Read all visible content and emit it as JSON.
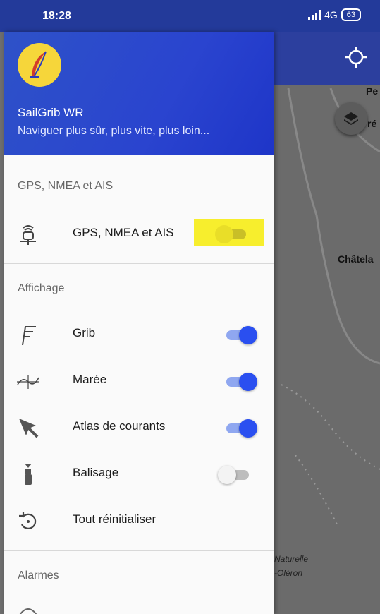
{
  "status_bar": {
    "time": "18:28",
    "network": "4G",
    "battery": "63"
  },
  "map": {
    "labels": {
      "pe": "Pe",
      "re": "ré",
      "chatelaillon": "Châtela",
      "naturelle": "Naturelle",
      "oleron": "-Oléron"
    }
  },
  "header": {
    "app_name": "SailGrib WR",
    "tagline": "Naviguer plus sûr, plus vite, plus loin..."
  },
  "sections": {
    "gps": {
      "title": "GPS, NMEA et AIS"
    },
    "display": {
      "title": "Affichage"
    },
    "alarms": {
      "title": "Alarmes"
    }
  },
  "items": {
    "gps": {
      "label": "GPS, NMEA et AIS",
      "icon": "antenna-icon",
      "enabled": false
    },
    "grib": {
      "label": "Grib",
      "icon": "wind-barb-icon",
      "enabled": true
    },
    "tide": {
      "label": "Marée",
      "icon": "tide-curve-icon",
      "enabled": true
    },
    "currents": {
      "label": "Atlas de courants",
      "icon": "arrow-pointer-icon",
      "enabled": true
    },
    "buoys": {
      "label": "Balisage",
      "icon": "buoy-icon",
      "enabled": false
    },
    "reset": {
      "label": "Tout réinitialiser",
      "icon": "reset-icon"
    }
  },
  "colors": {
    "accent": "#2a4ff0",
    "header": "#2a44cf",
    "highlight": "#f7ee2d"
  }
}
